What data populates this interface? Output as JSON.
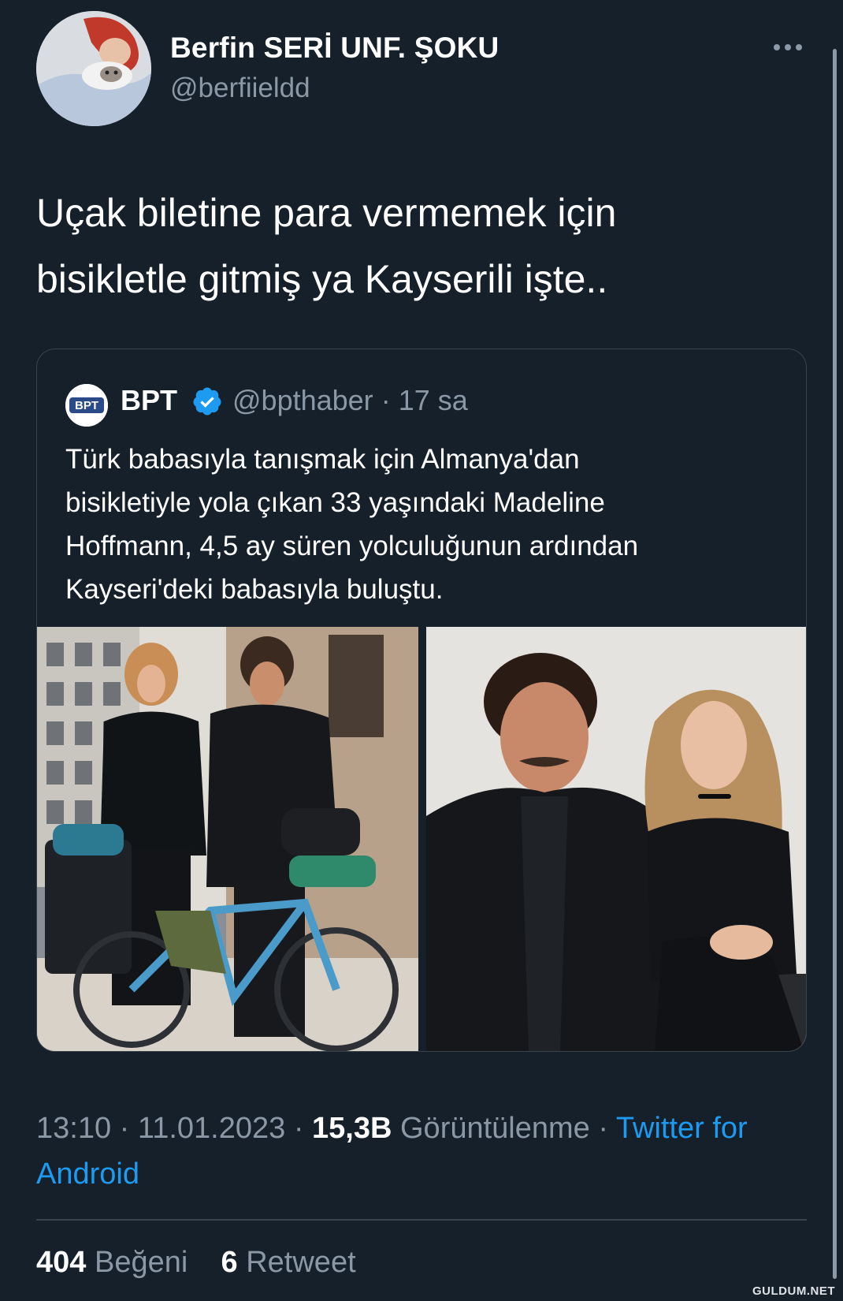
{
  "author": {
    "display_name": "Berfin SERİ UNF. ŞOKU",
    "handle": "@berfiieldd"
  },
  "tweet": {
    "text_line1": "Uçak biletine para vermemek için",
    "text_line2": "bisikletle gitmiş ya Kayserili işte.."
  },
  "quote": {
    "logo_text": "BPT",
    "name": "BPT",
    "handle": "@bpthaber",
    "separator": "·",
    "time": "17 sa",
    "text_lines": [
      "Türk babasıyla tanışmak için Almanya'dan",
      "bisikletiyle yola çıkan 33 yaşındaki Madeline",
      "Hoffmann, 4,5 ay süren yolculuğunun ardından",
      "Kayseri'deki babasıyla buluştu."
    ]
  },
  "meta": {
    "time": "13:10",
    "date": "11.01.2023",
    "views_count": "15,3B",
    "views_label": "Görüntülenme",
    "source": "Twitter for Android",
    "sep": "·"
  },
  "stats": {
    "likes_count": "404",
    "likes_label": "Beğeni",
    "retweets_count": "6",
    "retweets_label": "Retweet"
  },
  "watermark": "GULDUM.NET",
  "colors": {
    "background": "#15202b",
    "secondary_text": "#8b98a5",
    "link": "#1d9bf0",
    "border": "#38444d",
    "verified": "#1d9bf0"
  }
}
